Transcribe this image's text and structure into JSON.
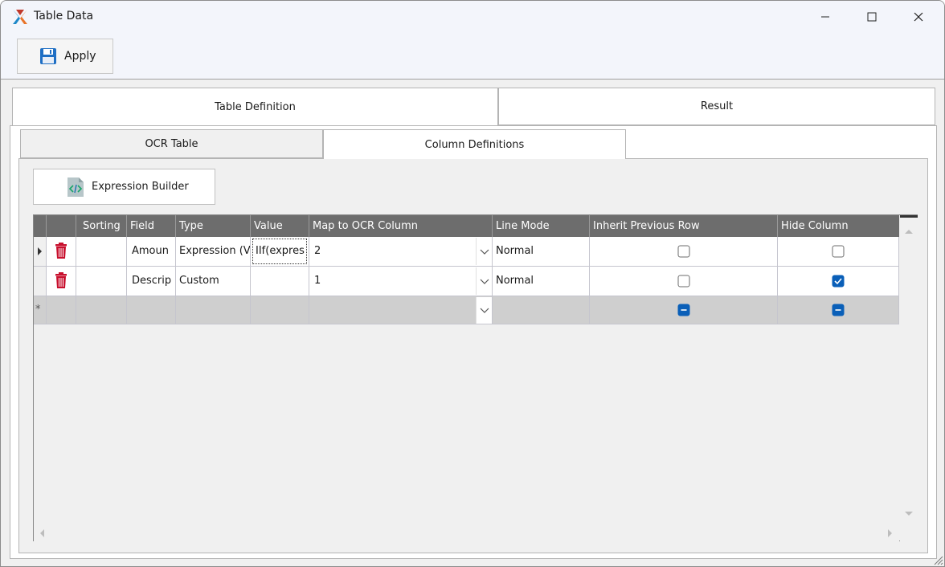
{
  "window": {
    "title": "Table Data"
  },
  "toolbar": {
    "apply_label": "Apply"
  },
  "outer_tabs": [
    {
      "label": "Table Definition",
      "selected": true
    },
    {
      "label": "Result",
      "selected": false
    }
  ],
  "inner_tabs": [
    {
      "label": "OCR Table",
      "selected": false
    },
    {
      "label": "Column Definitions",
      "selected": true
    }
  ],
  "expression_builder_label": "Expression Builder",
  "grid": {
    "headers": [
      "Sorting",
      "Field",
      "Type",
      "Value",
      "Map to OCR Column",
      "Line Mode",
      "Inherit Previous Row",
      "Hide Column"
    ],
    "rows": [
      {
        "sorting": "",
        "field": "Amoun",
        "type": "Expression (V",
        "value": "IIf(expres",
        "map": "2",
        "line_mode": "Normal",
        "inherit": false,
        "hide": false
      },
      {
        "sorting": "",
        "field": "Descrip",
        "type": "Custom",
        "value": "",
        "map": "1",
        "line_mode": "Normal",
        "inherit": false,
        "hide": true
      }
    ],
    "new_row_marker": "*"
  },
  "colors": {
    "accent": "#0a5fb8",
    "header_bg": "#6d6d6d",
    "delete_red": "#c8102e"
  }
}
